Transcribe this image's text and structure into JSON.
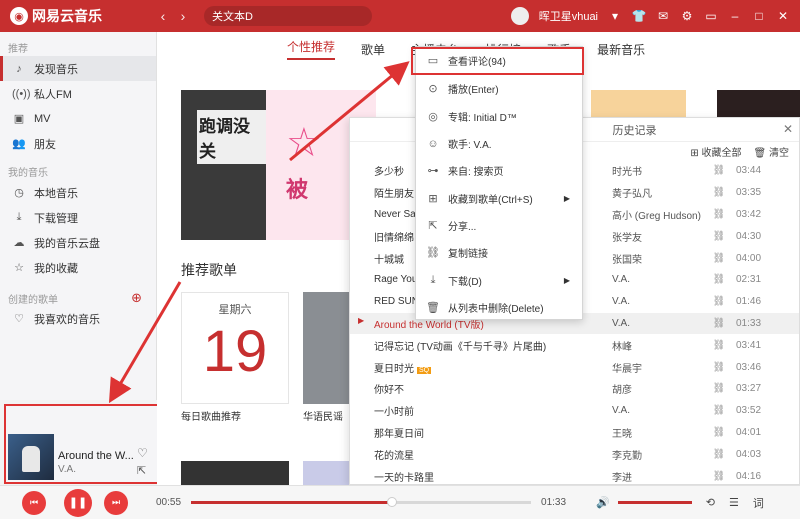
{
  "app": {
    "name": "网易云音乐",
    "logo_icon": "netease-cloud-music-logo"
  },
  "header": {
    "search_value": "关文本D",
    "username": "晖卫星vhuai",
    "icons": [
      "skin-icon",
      "mail-icon",
      "settings-icon",
      "mini-mode-icon",
      "minimize-icon",
      "maximize-icon",
      "close-icon"
    ]
  },
  "sidebar": {
    "recommend_title": "推荐",
    "items": [
      {
        "label": "发现音乐",
        "icon": "music-note-icon",
        "active": true
      },
      {
        "label": "私人FM",
        "icon": "radio-icon",
        "active": false
      },
      {
        "label": "MV",
        "icon": "video-icon",
        "active": false
      },
      {
        "label": "朋友",
        "icon": "friends-icon",
        "active": false
      }
    ],
    "my_music_title": "我的音乐",
    "my_items": [
      {
        "label": "本地音乐",
        "icon": "clock-icon"
      },
      {
        "label": "下载管理",
        "icon": "download-icon"
      },
      {
        "label": "我的音乐云盘",
        "icon": "cloud-icon"
      },
      {
        "label": "我的收藏",
        "icon": "star-icon"
      }
    ],
    "created_title": "创建的歌单",
    "created_items": [
      {
        "label": "我喜欢的音乐",
        "icon": "heart-icon"
      }
    ]
  },
  "now_playing": {
    "title": "Around the W...",
    "artist": "V.A."
  },
  "tabs": [
    {
      "label": "个性推荐",
      "active": true
    },
    {
      "label": "歌单",
      "active": false
    },
    {
      "label": "主播电台",
      "active": false
    },
    {
      "label": "排行榜",
      "active": false
    },
    {
      "label": "歌手",
      "active": false
    },
    {
      "label": "最新音乐",
      "active": false
    }
  ],
  "banners": {
    "text_a": "跑调没关",
    "text_b": "被"
  },
  "recommend": {
    "title": "推荐歌单",
    "weekday": "星期六",
    "day": "19",
    "daily_label": "每日歌曲推荐",
    "card2_label": "华语民谣"
  },
  "queue": {
    "tab_label": "历史记录",
    "tools": {
      "collect_all": "收藏全部",
      "clear": "清空"
    },
    "rows": [
      {
        "name": "多少秒",
        "artist": "时光书",
        "duration": "03:44",
        "playing": false,
        "badge": ""
      },
      {
        "name": "陌生朋友",
        "artist": "黄子弘凡",
        "duration": "03:35",
        "playing": false,
        "badge": ""
      },
      {
        "name": "Never Say Goodbye",
        "artist": "高小 (Greg Hudson)",
        "duration": "03:42",
        "playing": false,
        "badge": ""
      },
      {
        "name": "旧情绵绵",
        "artist": "张学友",
        "duration": "04:30",
        "playing": false,
        "badge": ""
      },
      {
        "name": "十城城",
        "artist": "张国荣",
        "duration": "04:00",
        "playing": false,
        "badge": ""
      },
      {
        "name": "Rage Your Dream",
        "artist": "V.A.",
        "duration": "02:31",
        "playing": false,
        "badge": ""
      },
      {
        "name": "RED SUN",
        "artist": "V.A.",
        "duration": "01:46",
        "playing": false,
        "badge": ""
      },
      {
        "name": "Around the World (TV版)",
        "artist": "V.A.",
        "duration": "01:33",
        "playing": true,
        "badge": ""
      },
      {
        "name": "记得忘记 (TV动画《千与千寻》片尾曲)",
        "artist": "林峰",
        "duration": "03:41",
        "playing": false,
        "badge": ""
      },
      {
        "name": "夏日时光",
        "artist": "华晨宇",
        "duration": "03:46",
        "playing": false,
        "badge": "SQ"
      },
      {
        "name": "你好不",
        "artist": "胡彦",
        "duration": "03:27",
        "playing": false,
        "badge": ""
      },
      {
        "name": "一小时前",
        "artist": "V.A.",
        "duration": "03:52",
        "playing": false,
        "badge": ""
      },
      {
        "name": "那年夏日间",
        "artist": "王晓",
        "duration": "04:01",
        "playing": false,
        "badge": ""
      },
      {
        "name": "花的流星",
        "artist": "李克勤",
        "duration": "04:03",
        "playing": false,
        "badge": ""
      },
      {
        "name": "一天的卡路里",
        "artist": "李进",
        "duration": "04:16",
        "playing": false,
        "badge": ""
      }
    ]
  },
  "context_menu": {
    "items": [
      {
        "label": "查看评论(94)",
        "icon": "comment-icon",
        "submenu": false
      },
      {
        "label": "播放(Enter)",
        "icon": "play-circle-icon",
        "submenu": false
      },
      {
        "label": "专辑: Initial D™",
        "icon": "album-icon",
        "submenu": false
      },
      {
        "label": "歌手: V.A.",
        "icon": "singer-icon",
        "submenu": false
      },
      {
        "label": "来自: 搜索页",
        "icon": "link-icon",
        "submenu": false
      },
      {
        "label": "收藏到歌单(Ctrl+S)",
        "icon": "add-folder-icon",
        "submenu": true
      },
      {
        "label": "分享...",
        "icon": "share-icon",
        "submenu": false
      },
      {
        "label": "复制链接",
        "icon": "copy-link-icon",
        "submenu": false
      },
      {
        "label": "下载(D)",
        "icon": "download-icon",
        "submenu": true
      },
      {
        "label": "从列表中删除(Delete)",
        "icon": "trash-icon",
        "submenu": false
      }
    ]
  },
  "player": {
    "current_time": "00:55",
    "total_time": "01:33",
    "progress": 0.59,
    "volume": 1.0,
    "lyric_label": "词"
  },
  "colors": {
    "brand": "#c62f2f",
    "annotation": "#dd3333"
  }
}
